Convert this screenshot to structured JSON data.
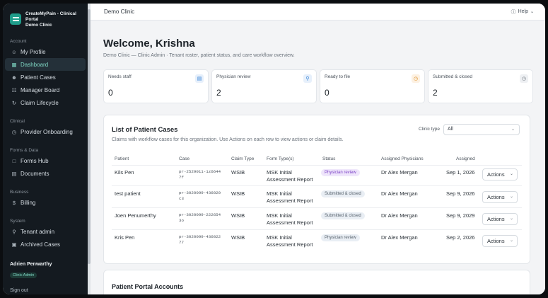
{
  "sidebar": {
    "brand_line1": "CreateMyPain - Clinical Portal",
    "brand_line2": "Demo Clinic",
    "sections": {
      "account": "Account",
      "clinical": "Clinical",
      "forms": "Forms & Data",
      "business": "Business",
      "system": "System"
    },
    "items": {
      "profile": "My Profile",
      "dashboard": "Dashboard",
      "patient_cases": "Patient Cases",
      "manager_board": "Manager Board",
      "claim_lifecycle": "Claim Lifecycle",
      "provider_onboarding": "Provider Onboarding",
      "forms_hub": "Forms Hub",
      "documents": "Documents",
      "billing": "Billing",
      "tenant_admin": "Tenant admin",
      "archived_cases": "Archived Cases"
    },
    "user": {
      "name": "Adrien Penwarthy",
      "role": "Clinic Admin"
    },
    "signout": "Sign out"
  },
  "topbar": {
    "title": "Demo Clinic",
    "help": "Help"
  },
  "header": {
    "welcome": "Welcome, Krishna",
    "subtitle": "Demo Clinic — Clinic Admin · Tenant roster, patient status, and care workflow overview."
  },
  "stats": [
    {
      "label": "Needs staff",
      "value": "0",
      "icon": "document-icon",
      "color": "#2f7fd6",
      "bg": "#e7f0fb"
    },
    {
      "label": "Physician review",
      "value": "2",
      "icon": "search-icon",
      "color": "#2f7fd6",
      "bg": "#e7f0fb"
    },
    {
      "label": "Ready to file",
      "value": "0",
      "icon": "clock-icon",
      "color": "#d98a1e",
      "bg": "#fdf1e2"
    },
    {
      "label": "Submitted & closed",
      "value": "2",
      "icon": "clock-icon",
      "color": "#6b737c",
      "bg": "#eef0f3"
    }
  ],
  "cases": {
    "title": "List of Patient Cases",
    "subtitle": "Claims with workflow cases for this organization. Use Actions on each row to view actions or claim details.",
    "filter_label": "Clinic type",
    "filter_value": "All",
    "columns": [
      "Patient",
      "Case",
      "Claim Type",
      "Form Type(s)",
      "Status",
      "Assigned Physicians",
      "Assigned"
    ],
    "rows": [
      {
        "patient": "Kils Pen",
        "case1": "pr-2529011-1z6644",
        "case2": "7f",
        "claim": "WSIB",
        "form1": "MSK Initial",
        "form2": "Assessment Report",
        "status": "Physician review",
        "status_style": "purple",
        "physician": "Dr Alex Mergan",
        "assigned": "Sep 1, 2026",
        "actions": "Actions"
      },
      {
        "patient": "test patient",
        "case1": "pr-3020099-436020",
        "case2": "c3",
        "claim": "WSIB",
        "form1": "MSK Initial",
        "form2": "Assessment Report",
        "status": "Submitted & closed",
        "status_style": "gray",
        "physician": "Dr Alex Mergan",
        "assigned": "Sep 9, 2026",
        "actions": "Actions"
      },
      {
        "patient": "Joen Penumerthy",
        "case1": "pr-3020099-222654",
        "case2": "3o",
        "claim": "WSIB",
        "form1": "MSK Initial",
        "form2": "Assessment Report",
        "status": "Submitted & closed",
        "status_style": "gray",
        "physician": "Dr Alex Mergan",
        "assigned": "Sep 9, 2029",
        "actions": "Actions"
      },
      {
        "patient": "Kris Pen",
        "case1": "pr-3020099-436022",
        "case2": "77",
        "claim": "WSIB",
        "form1": "MSK Initial",
        "form2": "Assessment Report",
        "status": "Physician review",
        "status_style": "gray",
        "physician": "Dr Alex Mergan",
        "assigned": "Sep 2, 2026",
        "actions": "Actions"
      }
    ]
  },
  "portal": {
    "title": "Patient Portal Accounts"
  }
}
